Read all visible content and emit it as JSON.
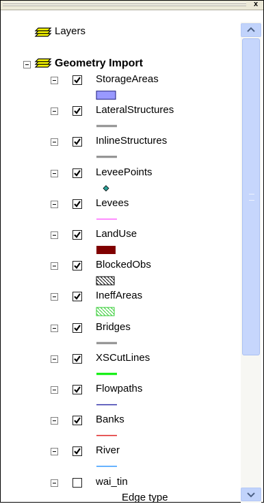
{
  "window": {
    "close_glyph": "x"
  },
  "header": {
    "layers_label": "Layers"
  },
  "group": {
    "label": "Geometry Import"
  },
  "layers": [
    {
      "label": "StorageAreas",
      "checked": true,
      "symbol": "storage-area-swatch",
      "color": "#9999ff"
    },
    {
      "label": "LateralStructures",
      "checked": true,
      "symbol": "line-swatch",
      "color": "#8c8c8c"
    },
    {
      "label": "InlineStructures",
      "checked": true,
      "symbol": "line-swatch",
      "color": "#8c8c8c"
    },
    {
      "label": "LeveePoints",
      "checked": true,
      "symbol": "point-swatch",
      "color": "#2aa198"
    },
    {
      "label": "Levees",
      "checked": true,
      "symbol": "line-swatch",
      "color": "#ff66ff"
    },
    {
      "label": "LandUse",
      "checked": true,
      "symbol": "fill-swatch",
      "color": "#800000"
    },
    {
      "label": "BlockedObs",
      "checked": true,
      "symbol": "hatch-swatch",
      "color": "#000000"
    },
    {
      "label": "IneffAreas",
      "checked": true,
      "symbol": "hatch-swatch",
      "color": "#33cc33"
    },
    {
      "label": "Bridges",
      "checked": true,
      "symbol": "line-swatch",
      "color": "#8c8c8c"
    },
    {
      "label": "XSCutLines",
      "checked": true,
      "symbol": "line-swatch",
      "color": "#00ee00"
    },
    {
      "label": "Flowpaths",
      "checked": true,
      "symbol": "line-swatch",
      "color": "#3333aa"
    },
    {
      "label": "Banks",
      "checked": true,
      "symbol": "line-swatch",
      "color": "#dd2222"
    },
    {
      "label": "River",
      "checked": true,
      "symbol": "line-swatch",
      "color": "#3399ff"
    },
    {
      "label": "wai_tin",
      "checked": false,
      "sublabel": "Edge type"
    }
  ]
}
